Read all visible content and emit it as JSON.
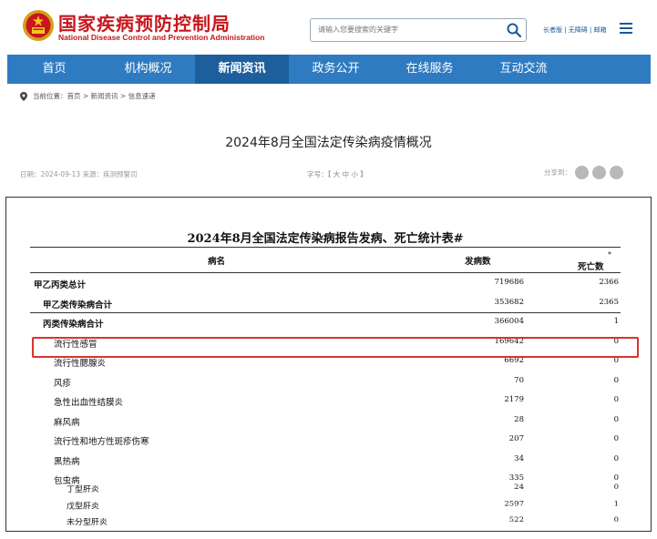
{
  "header": {
    "logo_cn": "国家疾病预防控制局",
    "logo_en": "National Disease Control and Prevention Administration",
    "search_placeholder": "请输入您要搜索的关键字",
    "top_links": "长者版 | 无障碍 | 邮箱"
  },
  "nav": {
    "items": [
      {
        "label": "首页"
      },
      {
        "label": "机构概况"
      },
      {
        "label": "新闻资讯"
      },
      {
        "label": "政务公开"
      },
      {
        "label": "在线服务"
      },
      {
        "label": "互动交流"
      }
    ],
    "active_index": 2
  },
  "breadcrumb": {
    "prefix": "当前位置：",
    "path": "首页 > 新闻资讯 > 信息速递"
  },
  "article": {
    "title": "2024年8月全国法定传染病疫情概况",
    "meta": "日期：2024-09-13  来源：疾测预警司",
    "font_size_label": "字号：【 大  中  小 】",
    "share_label": "分享到："
  },
  "table": {
    "title": "2024年8月全国法定传染病报告发病、死亡统计表#",
    "col_name": "病名",
    "col_cases": "发病数",
    "col_deaths": "死亡数",
    "deaths_mark": "*",
    "rows": [
      {
        "name": "甲乙丙类总计",
        "cases": "719686",
        "deaths": "2366",
        "indent": 0,
        "bold": true,
        "sep": false
      },
      {
        "name": "甲乙类传染病合计",
        "cases": "353682",
        "deaths": "2365",
        "indent": 1,
        "bold": true,
        "sep": true
      },
      {
        "name": "丙类传染病合计",
        "cases": "366004",
        "deaths": "1",
        "indent": 1,
        "bold": true,
        "sep": false
      },
      {
        "name": "流行性感冒",
        "cases": "169642",
        "deaths": "0",
        "indent": 2,
        "bold": false,
        "sep": false
      },
      {
        "name": "流行性腮腺炎",
        "cases": "6692",
        "deaths": "0",
        "indent": 2,
        "bold": false,
        "sep": false
      },
      {
        "name": "风疹",
        "cases": "70",
        "deaths": "0",
        "indent": 2,
        "bold": false,
        "sep": false
      },
      {
        "name": "急性出血性结膜炎",
        "cases": "2179",
        "deaths": "0",
        "indent": 2,
        "bold": false,
        "sep": false
      },
      {
        "name": "麻风病",
        "cases": "28",
        "deaths": "0",
        "indent": 2,
        "bold": false,
        "sep": false
      },
      {
        "name": "流行性和地方性斑疹伤寒",
        "cases": "207",
        "deaths": "0",
        "indent": 2,
        "bold": false,
        "sep": false
      },
      {
        "name": "黑热病",
        "cases": "34",
        "deaths": "0",
        "indent": 2,
        "bold": false,
        "sep": false
      },
      {
        "name": "包虫病",
        "cases": "335",
        "deaths": "0",
        "indent": 2,
        "bold": false,
        "sep": false
      }
    ],
    "sub_rows": [
      {
        "name": "丁型肝炎",
        "cases": "24",
        "deaths": "0"
      },
      {
        "name": "戊型肝炎",
        "cases": "2597",
        "deaths": "1"
      },
      {
        "name": "未分型肝炎",
        "cases": "522",
        "deaths": "0"
      }
    ]
  },
  "colors": {
    "brand_red": "#c8161d",
    "nav_blue": "#2f7bc1",
    "nav_active": "#1d5f9c",
    "highlight": "#d9342b"
  }
}
